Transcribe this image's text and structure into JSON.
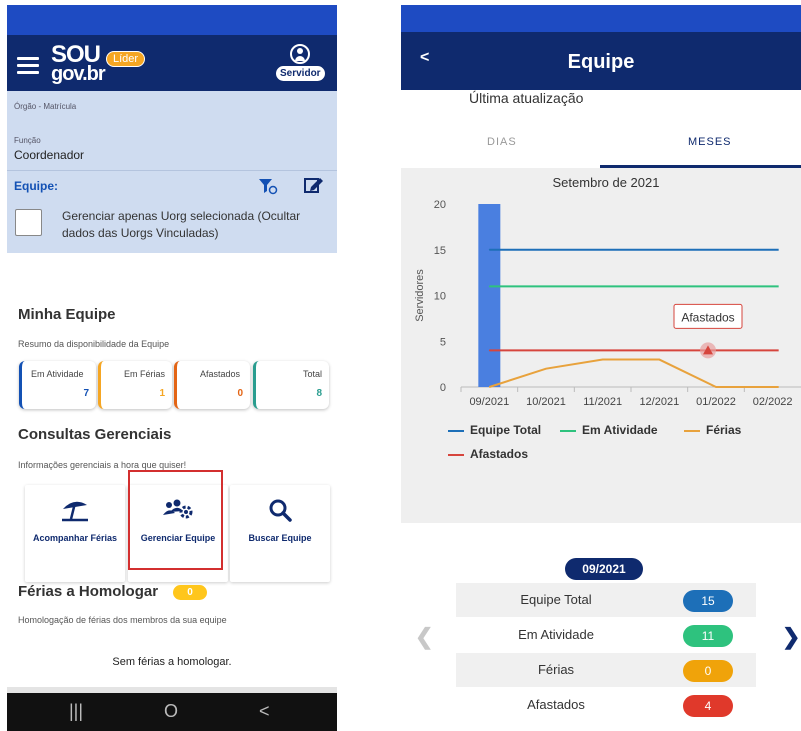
{
  "left": {
    "logo": {
      "top": "SOU",
      "bottom": "gov.br"
    },
    "lider_badge": "Líder",
    "user_badge": "Servidor",
    "orgao_label": "Órgão - Matrícula",
    "funcao_label": "Função",
    "funcao_value": "Coordenador",
    "equipe_label": "Equipe:",
    "checkbox_text": "Gerenciar apenas Uorg selecionada (Ocultar dados das Uorgs Vinculadas)",
    "minha_equipe": {
      "title": "Minha Equipe",
      "subtitle": "Resumo da disponibilidade da Equipe",
      "stats": [
        {
          "label": "Em Atividade",
          "value": "7",
          "color": "#1351b4"
        },
        {
          "label": "Em Férias",
          "value": "1",
          "color": "#f5a623"
        },
        {
          "label": "Afastados",
          "value": "0",
          "color": "#e36414"
        },
        {
          "label": "Total",
          "value": "8",
          "color": "#2a9d8f"
        }
      ]
    },
    "consultas": {
      "title": "Consultas Gerenciais",
      "subtitle": "Informações gerenciais a hora que quiser!",
      "tiles": [
        {
          "label": "Acompanhar Férias",
          "icon": "beach-umbrella-icon"
        },
        {
          "label": "Gerenciar Equipe",
          "icon": "team-gear-icon"
        },
        {
          "label": "Buscar Equipe",
          "icon": "search-icon"
        }
      ]
    },
    "ferias_homologar": {
      "title": "Férias a Homologar",
      "badge": "0",
      "subtitle": "Homologação de férias dos membros da sua equipe",
      "empty": "Sem férias a homologar."
    },
    "nav": {
      "recent": "|||",
      "home": "O",
      "back": "<"
    }
  },
  "right": {
    "back": "<",
    "title": "Equipe",
    "ultima": "Última atualização",
    "tabs": [
      "DIAS",
      "MESES"
    ],
    "active_tab": "MESES",
    "selected_date": "09/2021",
    "rows": [
      {
        "label": "Equipe Total",
        "value": "15",
        "color": "#1d6fb8"
      },
      {
        "label": "Em Atividade",
        "value": "11",
        "color": "#2ec27e"
      },
      {
        "label": "Férias",
        "value": "0",
        "color": "#f0a30a"
      },
      {
        "label": "Afastados",
        "value": "4",
        "color": "#e0392b"
      }
    ]
  },
  "chart_data": {
    "type": "line",
    "title": "Setembro de 2021",
    "ylabel": "Servidores",
    "xlabel": "",
    "ylim": [
      0,
      20
    ],
    "yticks": [
      0,
      5,
      10,
      15,
      20
    ],
    "categories": [
      "09/2021",
      "10/2021",
      "11/2021",
      "12/2021",
      "01/2022",
      "02/2022"
    ],
    "series": [
      {
        "name": "Equipe Total",
        "color": "#1d6fb8",
        "values": [
          15,
          15,
          15,
          15,
          15,
          15
        ]
      },
      {
        "name": "Em Atividade",
        "color": "#2ec27e",
        "values": [
          11,
          11,
          11,
          11,
          11,
          11
        ]
      },
      {
        "name": "Férias",
        "color": "#e8a23c",
        "values": [
          0,
          2,
          3,
          3,
          0,
          0
        ]
      },
      {
        "name": "Afastados",
        "color": "#d6453d",
        "values": [
          4,
          4,
          4,
          4,
          4,
          4
        ]
      }
    ],
    "highlight_category": "09/2021",
    "highlight_color": "#4a7fe0",
    "tooltip": {
      "label": "Afastados",
      "category": "01/2022"
    },
    "grid": false,
    "legend_position": "bottom"
  }
}
